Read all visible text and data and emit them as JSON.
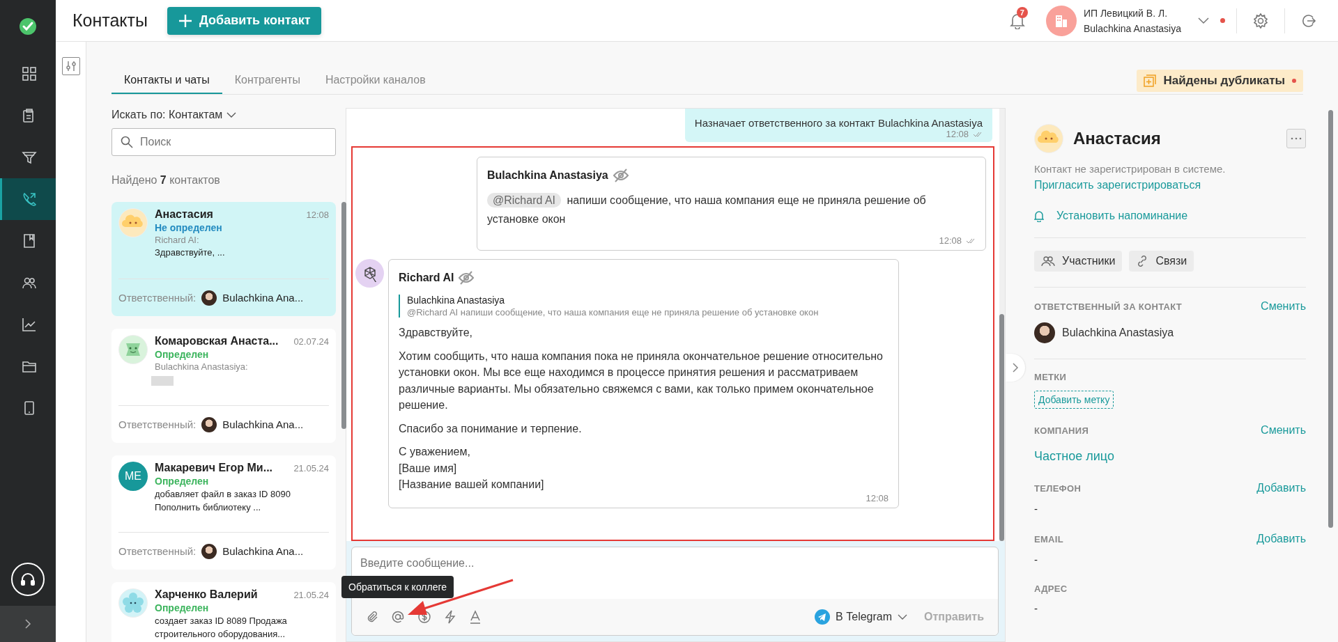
{
  "sidebar": {
    "items": [
      {
        "kind": "dashboard",
        "selected": false
      },
      {
        "kind": "tasks",
        "selected": false
      },
      {
        "kind": "funnel",
        "selected": false
      },
      {
        "kind": "contacts",
        "selected": true
      },
      {
        "kind": "book",
        "selected": false
      },
      {
        "kind": "team",
        "selected": false
      },
      {
        "kind": "chart",
        "selected": false
      },
      {
        "kind": "folder",
        "selected": false
      },
      {
        "kind": "device",
        "selected": false
      }
    ]
  },
  "header": {
    "title": "Контакты",
    "add_button": "Добавить контакт",
    "notifications_count": "7",
    "account": {
      "company": "ИП Левицкий В. Л.",
      "user": "Bulachkina Anastasiya",
      "alert": true
    }
  },
  "tabs": [
    {
      "label": "Контакты и чаты",
      "selected": true
    },
    {
      "label": "Контрагенты",
      "selected": false
    },
    {
      "label": "Настройки каналов",
      "selected": false
    }
  ],
  "duplicates_badge": {
    "label": "Найдены дубликаты",
    "alert": true
  },
  "contacts": {
    "search_by": "Искать по: Контактам",
    "search": {
      "placeholder": "Поиск"
    },
    "found": "Найдено **7** контактов",
    "items": [
      {
        "kind": "cloud",
        "name": "Анастасия",
        "time": "12:08",
        "status": "Не определен",
        "identified": false,
        "sender": "Richard AI:",
        "preview": "Здравствуйте, ...",
        "attachment": false,
        "responsible_label": "Ответственный:",
        "responsible": "Bulachkina Ana...",
        "selected": true
      },
      {
        "kind": "robot",
        "name": "Комаровская Анаста...",
        "time": "02.07.24",
        "status": "Определен",
        "identified": true,
        "sender": "Bulachkina Anastasiya:",
        "attachment": true,
        "responsible_label": "Ответственный:",
        "responsible": "Bulachkina Ana...",
        "selected": false
      },
      {
        "kind": "initials",
        "initials": "ME",
        "name": "Макаревич Егор Ми...",
        "time": "21.05.24",
        "status": "Определен",
        "identified": true,
        "preview": "добавляет файл в заказ ID 8090 Пополнить библиотеку ...",
        "attachment": false,
        "responsible_label": "Ответственный:",
        "responsible": "Bulachkina Ana...",
        "selected": false
      },
      {
        "kind": "flower",
        "name": "Харченко Валерий",
        "time": "21.05.24",
        "status": "Определен",
        "identified": true,
        "preview": "создает заказ ID 8089 Продажа строительного оборудования...",
        "attachment": false,
        "selected": false
      }
    ]
  },
  "chat": {
    "messages": [
      {
        "kind": "system",
        "text": "Назначает ответственного за контакт Bulachkina Anastasiya",
        "time": "12:08",
        "read": true
      }
    ],
    "frame": true,
    "framed_messages": [
      {
        "kind": "outgoing",
        "author": "Bulachkina Anastasiya",
        "mention": "@Richard AI",
        "text": "напиши сообщение, что наша компания еще не приняла решение об установке окон",
        "time": "12:08",
        "read": true
      },
      {
        "kind": "incoming",
        "author": "Richard AI",
        "quote_author": "Bulachkina Anastasiya",
        "quote_text": "@Richard AI напиши сообщение, что наша компания еще не приняла решение об установке окон",
        "paragraphs": [
          [
            "Здравствуйте,"
          ],
          [
            "Хотим сообщить, что наша компания пока не приняла окончательное решение относительно установки окон. Мы все еще находимся в процессе принятия решения и рассматриваем различные варианты. Мы обязательно свяжемся с вами, как только примем окончательное решение."
          ],
          [
            "Спасибо за понимание и терпение."
          ],
          [
            "С уважением,",
            "[Ваше имя]",
            "[Название вашей компании]"
          ]
        ],
        "time": "12:08"
      }
    ],
    "composer": {
      "placeholder": "Введите сообщение...",
      "tooltip": "Обратиться к коллеге",
      "channel": "В Telegram",
      "send": "Отправить",
      "send_disabled": true
    }
  },
  "details": {
    "name": "Анастасия",
    "note": "Контакт не зарегистрирован в системе.",
    "invite": "Пригласить зарегистрироваться",
    "reminder": "Установить напоминание",
    "buttons": [
      "Участники",
      "Связи"
    ],
    "responsible": {
      "label": "ОТВЕТСТВЕННЫЙ ЗА КОНТАКТ",
      "action": "Сменить",
      "person": "Bulachkina Anastasiya"
    },
    "tags": {
      "label": "МЕТКИ",
      "add": "Добавить метку"
    },
    "company": {
      "label": "КОМПАНИЯ",
      "action": "Сменить",
      "value": "Частное лицо"
    },
    "fields": [
      {
        "label": "ТЕЛЕФОН",
        "action": "Добавить",
        "value": "-"
      },
      {
        "label": "EMAIL",
        "action": "Добавить",
        "value": "-"
      },
      {
        "label": "АДРЕС",
        "value": "-"
      }
    ]
  }
}
